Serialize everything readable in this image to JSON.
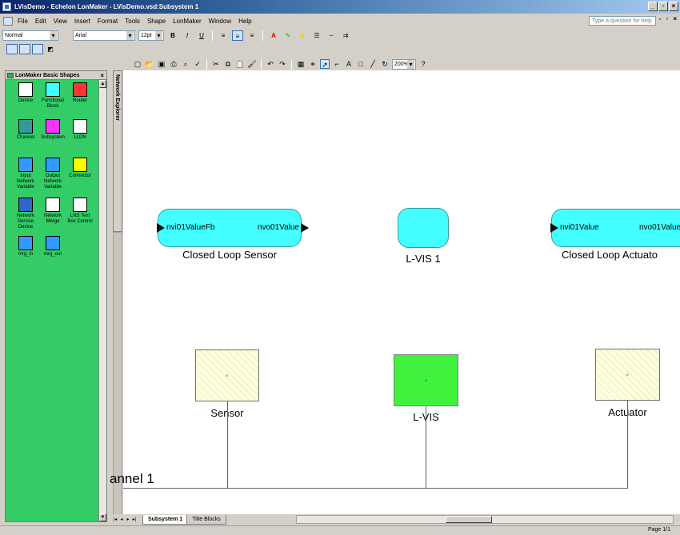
{
  "window": {
    "title": "LVisDemo - Echelon LonMaker - LVisDemo.vsd:Subsystem 1",
    "controls": [
      "_",
      "▫",
      "×"
    ]
  },
  "menubar": {
    "items": [
      "File",
      "Edit",
      "View",
      "Insert",
      "Format",
      "Tools",
      "Shape",
      "LonMaker",
      "Window",
      "Help"
    ],
    "help_placeholder": "Type a question for help",
    "doc_controls": [
      "-",
      "▫",
      "×"
    ]
  },
  "format_toolbar": {
    "style": "Normal",
    "font": "Arial",
    "size": "12pt"
  },
  "standard_toolbar": {
    "zoom": "200%"
  },
  "stencil": {
    "title": "LonMaker Basic Shapes",
    "close": "×",
    "shapes": [
      {
        "label": "Device",
        "icon": "device-icon",
        "color": "#ffffff"
      },
      {
        "label": "Functional Block",
        "icon": "functional-block-icon",
        "color": "#44ffff"
      },
      {
        "label": "Router",
        "icon": "router-icon",
        "color": "#ff3333"
      },
      {
        "label": "Channel",
        "icon": "channel-icon",
        "color": "#339999"
      },
      {
        "label": "Subsystem",
        "icon": "subsystem-icon",
        "color": "#ff33ff"
      },
      {
        "label": "LLDN",
        "icon": "lldn-icon",
        "color": "#ffffff"
      },
      {
        "label": "Input Network Variable",
        "icon": "input-nv-icon",
        "color": "#3399ff"
      },
      {
        "label": "Output Network Variable",
        "icon": "output-nv-icon",
        "color": "#3399ff"
      },
      {
        "label": "Connector",
        "icon": "connector-icon",
        "color": "#ffff00"
      },
      {
        "label": "Network Service Device",
        "icon": "network-service-device-icon",
        "color": "#3366cc"
      },
      {
        "label": "Network Merge",
        "icon": "network-merge-icon",
        "color": "#ffffff"
      },
      {
        "label": "LNS Text Box Control",
        "icon": "lns-textbox-icon",
        "color": "#ffffff"
      },
      {
        "label": "mrg_in",
        "icon": "mrg-in-icon",
        "color": "#3399ff"
      },
      {
        "label": "mrg_out",
        "icon": "mrg-out-icon",
        "color": "#3399ff"
      }
    ]
  },
  "network_explorer": {
    "label": "Network Explorer"
  },
  "diagram": {
    "function_blocks": [
      {
        "caption": "Closed Loop Sensor",
        "in_port": "nvi01ValueFb",
        "out_port": "nvo01Value"
      },
      {
        "caption": "L-VIS 1"
      },
      {
        "caption": "Closed Loop Actuato",
        "in_port": "nvi01Value",
        "out_port": "nvo01Value"
      }
    ],
    "devices": [
      {
        "caption": "Sensor",
        "state": "hatched"
      },
      {
        "caption": "L-VIS",
        "state": "commissioned"
      },
      {
        "caption": "Actuator",
        "state": "hatched"
      }
    ],
    "channel_label": "annel 1"
  },
  "page_tabs": {
    "tabs": [
      "Subsystem 1",
      "Title Blocks"
    ],
    "active": "Subsystem 1"
  },
  "status": {
    "page": "Page 1/1"
  }
}
